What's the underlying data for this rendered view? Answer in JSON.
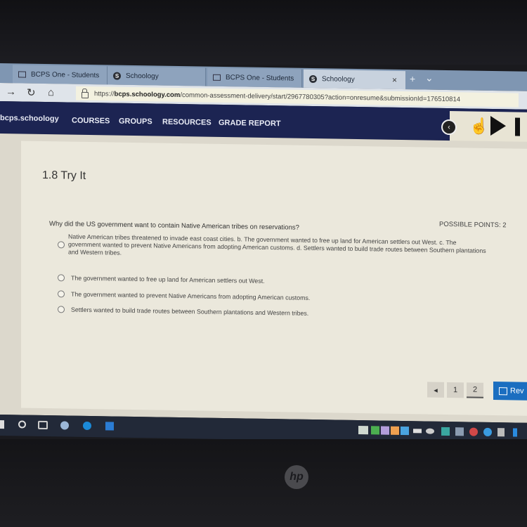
{
  "browser": {
    "tabs": [
      {
        "label": "BCPS One - Students",
        "icon": "page-icon",
        "active": false
      },
      {
        "label": "Schoology",
        "icon": "schoology-icon",
        "active": false
      },
      {
        "label": "BCPS One - Students",
        "icon": "page-icon",
        "active": false
      },
      {
        "label": "Schoology",
        "icon": "schoology-icon",
        "active": true
      }
    ],
    "close_glyph": "×",
    "new_tab_glyph": "+",
    "tab_menu_glyph": "⌄",
    "forward_glyph": "→",
    "refresh_glyph": "↻",
    "home_glyph": "⌂",
    "url_prefix": "https://",
    "url_domain": "bcps.schoology.com",
    "url_path": "/common-assessment-delivery/start/2967780305?action=onresume&submissionId=176510814"
  },
  "schoology_nav": {
    "brand": "bcps.schoology",
    "items": [
      "COURSES",
      "GROUPS",
      "RESOURCES",
      "GRADE REPORT"
    ]
  },
  "toolbox": {
    "back_glyph": "‹",
    "hand_glyph": "☝"
  },
  "assessment": {
    "title": "1.8 Try It",
    "possible_points": "POSSIBLE POINTS: 2",
    "question": "Why did the US government want to contain Native American tribes on reservations?",
    "options": [
      "Native American tribes threatened to invade east coast cities. b. The government wanted to free up land for American settlers out West. c. The government wanted to prevent Native Americans from adopting American customs. d. Settlers wanted to build trade routes between Southern plantations and Western tribes.",
      "The government wanted to free up land for American settlers out West.",
      "The government wanted to prevent Native Americans from adopting American customs.",
      "Settlers wanted to build trade routes between Southern plantations and Western tribes."
    ]
  },
  "pager": {
    "prev_glyph": "◂",
    "pages": [
      "1",
      "2"
    ],
    "current_page": "2",
    "review_label": "Rev"
  },
  "colors": {
    "nav_bg": "#1c2452",
    "review_button": "#1b6ec0"
  },
  "logo": "hp"
}
